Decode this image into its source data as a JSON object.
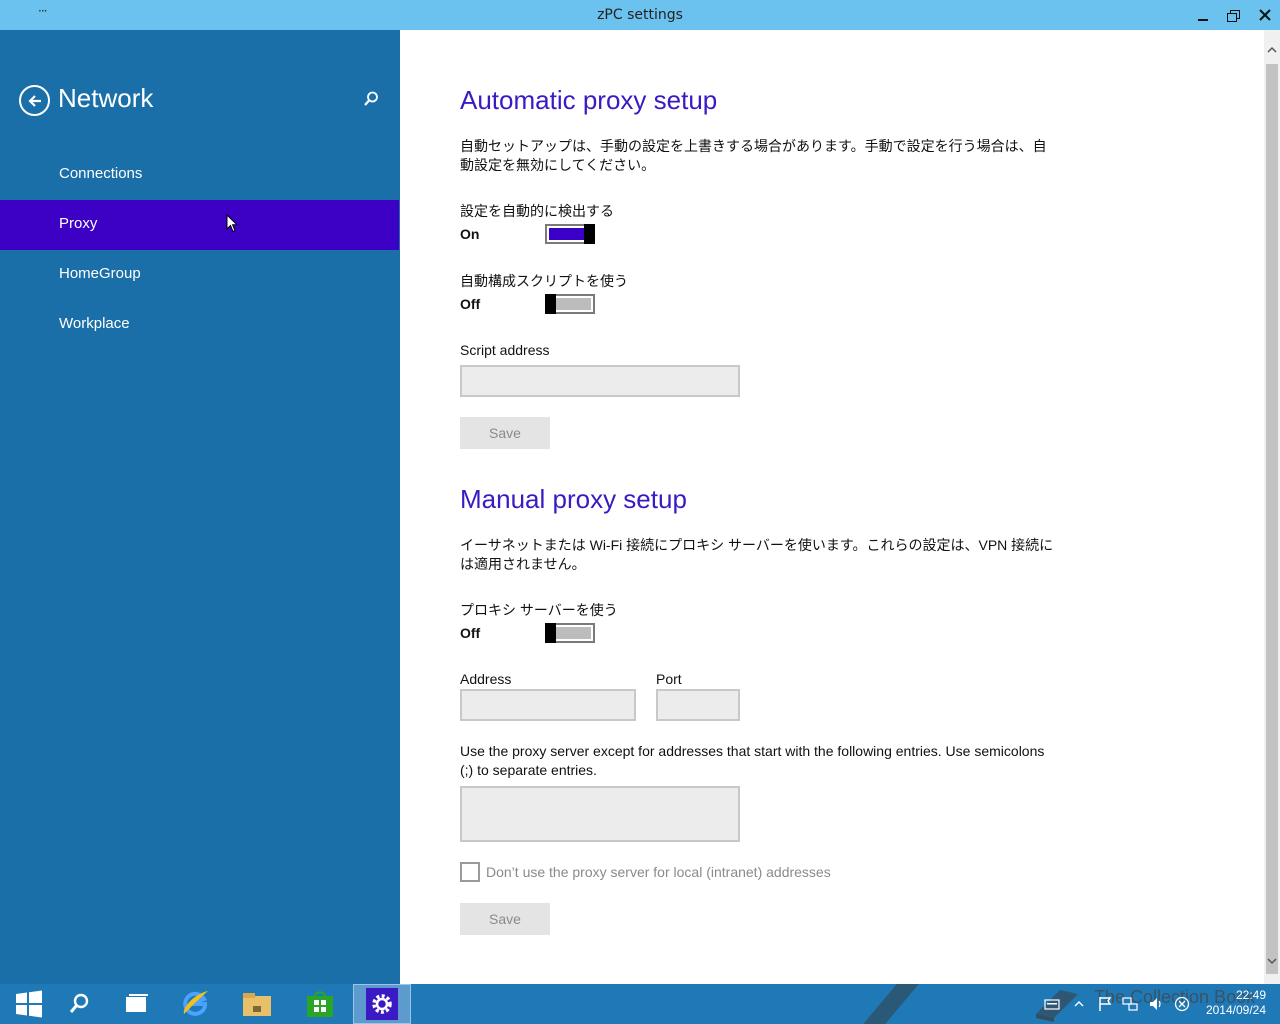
{
  "window": {
    "title": "zPC settings",
    "menu_label": "···"
  },
  "sidebar": {
    "title": "Network",
    "items": [
      {
        "label": "Connections",
        "selected": false
      },
      {
        "label": "Proxy",
        "selected": true
      },
      {
        "label": "HomeGroup",
        "selected": false
      },
      {
        "label": "Workplace",
        "selected": false
      }
    ]
  },
  "automatic": {
    "title": "Automatic proxy setup",
    "description": "自動セットアップは、手動の設定を上書きする場合があります。手動で設定を行う場合は、自動設定を無効にしてください。",
    "detect_label": "設定を自動的に検出する",
    "detect_state": "On",
    "script_toggle_label": "自動構成スクリプトを使う",
    "script_toggle_state": "Off",
    "script_address_label": "Script address",
    "script_address_value": "",
    "save_label": "Save"
  },
  "manual": {
    "title": "Manual proxy setup",
    "description": "イーサネットまたは Wi-Fi 接続にプロキシ サーバーを使います。これらの設定は、VPN 接続には適用されません。",
    "use_proxy_label": "プロキシ サーバーを使う",
    "use_proxy_state": "Off",
    "address_label": "Address",
    "address_value": "",
    "port_label": "Port",
    "port_value": "",
    "exceptions_description": "Use the proxy server except for addresses that start with the following entries. Use semicolons (;) to separate entries.",
    "exceptions_value": "",
    "local_checkbox_label": "Don’t use the proxy server for local (intranet) addresses",
    "local_checkbox_checked": false,
    "save_label": "Save"
  },
  "taskbar": {
    "apps": [
      "start-icon",
      "search-icon",
      "task-view-icon",
      "internet-explorer-icon",
      "file-explorer-icon",
      "store-icon",
      "settings-icon"
    ],
    "clock_time": "22:49",
    "clock_date": "2014/09/24",
    "watermark": "The Collection Book"
  },
  "colors": {
    "sidebar_bg": "#1a6fa8",
    "selected_bg": "#3d00c5",
    "title_accent": "#3b1ac4",
    "titlebar_bg": "#6cc2ee"
  }
}
